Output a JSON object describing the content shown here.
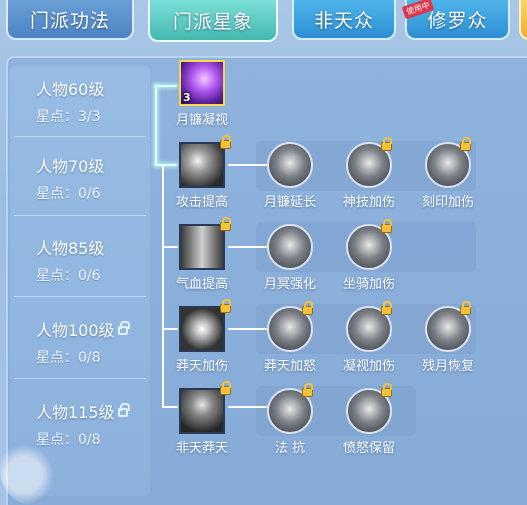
{
  "tabs": [
    {
      "label": "门派功法"
    },
    {
      "label": "门派星象"
    },
    {
      "label": "非天众"
    },
    {
      "label": "修罗众",
      "badge": "使用中"
    }
  ],
  "levels": [
    {
      "name": "人物60级",
      "stars": "星点：3/3",
      "locked": false
    },
    {
      "name": "人物70级",
      "stars": "星点：0/6",
      "locked": false
    },
    {
      "name": "人物85级",
      "stars": "星点：0/6",
      "locked": false
    },
    {
      "name": "人物100级",
      "stars": "星点：0/8",
      "locked": true
    },
    {
      "name": "人物115级",
      "stars": "星点：0/8",
      "locked": true
    }
  ],
  "skills": {
    "row1": [
      {
        "label": "月镰凝视",
        "count": "3",
        "icon": "purple-crescent-icon",
        "locked": false
      }
    ],
    "row2": [
      {
        "label": "攻击提高",
        "icon": "claw-slash-icon",
        "locked": true
      },
      {
        "label": "月镰延长",
        "icon": "crescent-blade-icon",
        "locked": false
      },
      {
        "label": "神技加伤",
        "icon": "demon-mask-icon",
        "locked": true
      },
      {
        "label": "刻印加伤",
        "icon": "rune-mark-icon",
        "locked": true
      }
    ],
    "row3": [
      {
        "label": "气血提高",
        "icon": "heart-icon",
        "locked": true
      },
      {
        "label": "月冥强化",
        "icon": "dark-orb-icon",
        "locked": false
      },
      {
        "label": "坐骑加伤",
        "icon": "beast-mount-icon",
        "locked": true
      }
    ],
    "row4": [
      {
        "label": "莽天加伤",
        "icon": "burst-icon",
        "locked": true
      },
      {
        "label": "莽天加怒",
        "icon": "burst-fist-icon",
        "locked": true
      },
      {
        "label": "凝视加伤",
        "icon": "gaze-moon-icon",
        "locked": true
      },
      {
        "label": "残月恢复",
        "icon": "moon-ring-icon",
        "locked": true
      }
    ],
    "row5": [
      {
        "label": "非天莽天",
        "icon": "asura-warrior-icon",
        "locked": true
      },
      {
        "label": "法 抗",
        "icon": "asura-warrior-icon",
        "locked": true
      },
      {
        "label": "愤怒保留",
        "icon": "asura-fury-icon",
        "locked": true
      }
    ]
  },
  "colors": {
    "active_tab": "#45b7b2",
    "tab": "#4c84c4",
    "lock": "#f2c23a",
    "connector_glow": "#b8fbff"
  }
}
